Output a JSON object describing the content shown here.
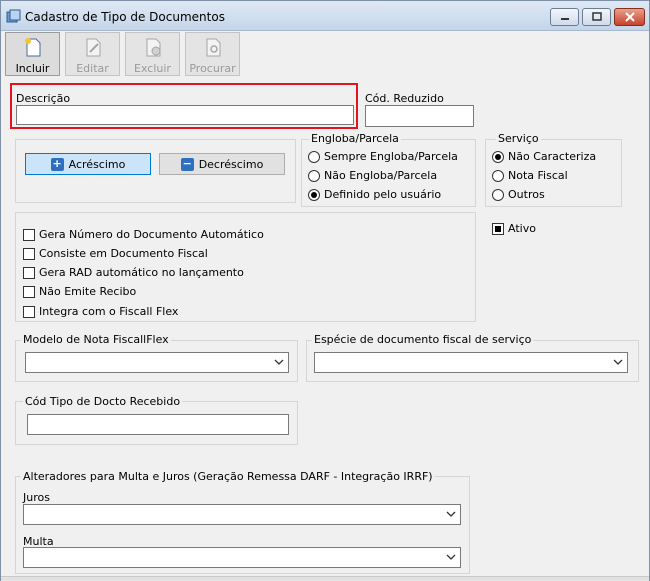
{
  "window": {
    "title": "Cadastro de Tipo de Documentos",
    "icons": {
      "app": "document-stack-icon",
      "minimize": "minimize-icon",
      "maximize": "maximize-icon",
      "close": "close-icon"
    }
  },
  "toolbar": {
    "incluir": {
      "label": "Incluir",
      "icon": "new-document-icon"
    },
    "editar": {
      "label": "Editar",
      "icon": "edit-document-icon"
    },
    "excluir": {
      "label": "Excluir",
      "icon": "delete-document-icon"
    },
    "procurar": {
      "label": "Procurar",
      "icon": "search-document-icon"
    }
  },
  "form": {
    "descricao_label": "Descrição",
    "descricao_value": "",
    "cod_reduzido_label": "Cód. Reduzido",
    "cod_reduzido_value": "",
    "acrescimo_label": "Acréscimo",
    "decrescimo_label": "Decréscimo",
    "engloba": {
      "legend": "Engloba/Parcela",
      "options": [
        "Sempre Engloba/Parcela",
        "Não Engloba/Parcela",
        "Definido pelo usuário"
      ],
      "selected": "Definido pelo usuário"
    },
    "servico": {
      "legend": "Serviço",
      "options": [
        "Não Caracteriza",
        "Nota Fiscal",
        "Outros"
      ],
      "selected": "Não Caracteriza"
    },
    "ativo_label": "Ativo",
    "ativo_checked": true,
    "checks": [
      {
        "label": "Gera Número do Documento Automático",
        "checked": false
      },
      {
        "label": "Consiste em Documento Fiscal",
        "checked": false
      },
      {
        "label": "Gera RAD automático no lançamento",
        "checked": false
      },
      {
        "label": "Não Emite Recibo",
        "checked": false
      },
      {
        "label": "Integra com o Fiscall Flex",
        "checked": false
      }
    ],
    "modelo_legend": "Modelo de Nota FiscallFlex",
    "modelo_value": "",
    "especie_legend": "Espécie de documento fiscal de serviço",
    "especie_value": "",
    "cod_tipo_legend": "Cód Tipo de Docto Recebido",
    "cod_tipo_value": "",
    "alteradores_legend": "Alteradores para Multa e Juros (Geração Remessa DARF - Integração IRRF)",
    "juros_label": "Juros",
    "juros_value": "",
    "multa_label": "Multa",
    "multa_value": ""
  },
  "colors": {
    "highlight": "#e0151f",
    "accent": "#2f6fc0"
  }
}
